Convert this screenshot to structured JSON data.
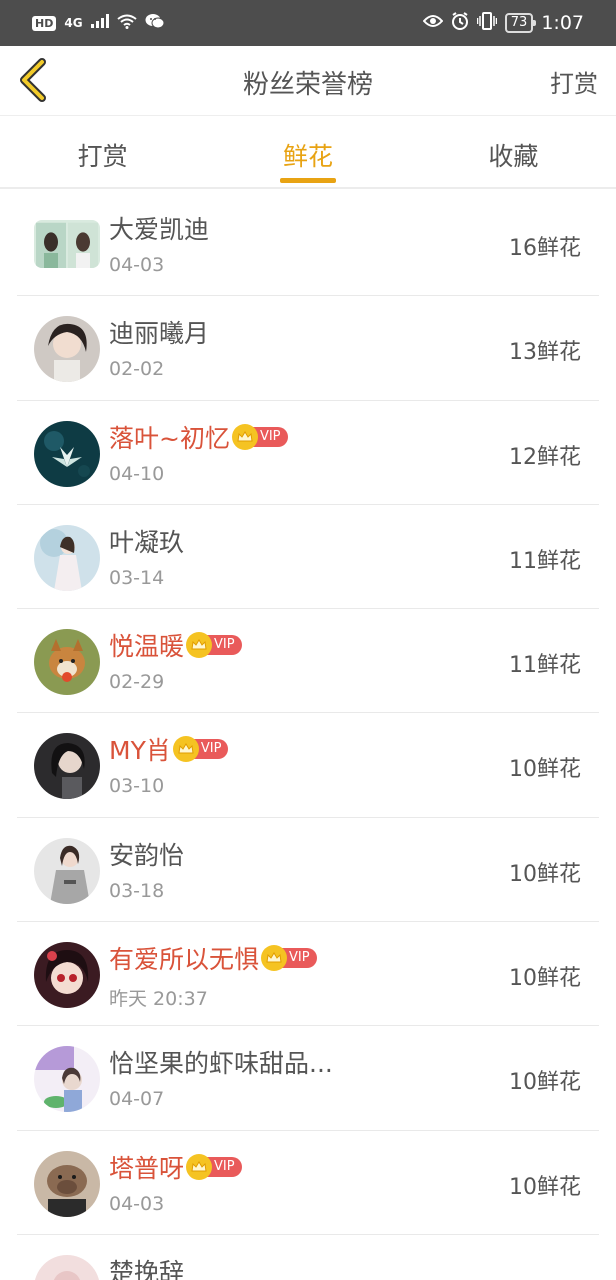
{
  "status_bar": {
    "left_hd": "HD",
    "left_network": "4G",
    "battery": "73",
    "time": "1:07",
    "icons": [
      "signal-icon",
      "wifi-icon",
      "wechat-icon",
      "eye-icon",
      "alarm-icon",
      "vibrate-icon",
      "battery-icon"
    ]
  },
  "header": {
    "back_icon": "chevron-left-icon",
    "title": "粉丝荣誉榜",
    "action": "打赏",
    "accent_color": "#e8a313"
  },
  "tabs": [
    {
      "label": "打赏",
      "active": false
    },
    {
      "label": "鲜花",
      "active": true
    },
    {
      "label": "收藏",
      "active": false
    }
  ],
  "vip_label": "VIP",
  "fans": [
    {
      "name": "大爱凯迪",
      "date": "04-03",
      "count": "16鲜花",
      "vip": false
    },
    {
      "name": "迪丽曦月",
      "date": "02-02",
      "count": "13鲜花",
      "vip": false
    },
    {
      "name": "落叶~初忆",
      "date": "04-10",
      "count": "12鲜花",
      "vip": true
    },
    {
      "name": "叶凝玖",
      "date": "03-14",
      "count": "11鲜花",
      "vip": false
    },
    {
      "name": "悦温暖",
      "date": "02-29",
      "count": "11鲜花",
      "vip": true
    },
    {
      "name": "MY肖",
      "date": "03-10",
      "count": "10鲜花",
      "vip": true
    },
    {
      "name": "安韵怡",
      "date": "03-18",
      "count": "10鲜花",
      "vip": false
    },
    {
      "name": "有爱所以无惧",
      "date": "昨天 20:37",
      "count": "10鲜花",
      "vip": true
    },
    {
      "name": "恰坚果的虾味甜品...",
      "date": "04-07",
      "count": "10鲜花",
      "vip": false
    },
    {
      "name": "塔普呀",
      "date": "04-03",
      "count": "10鲜花",
      "vip": true
    },
    {
      "name": "楚挽辞",
      "date": "",
      "count": "",
      "vip": false
    }
  ]
}
